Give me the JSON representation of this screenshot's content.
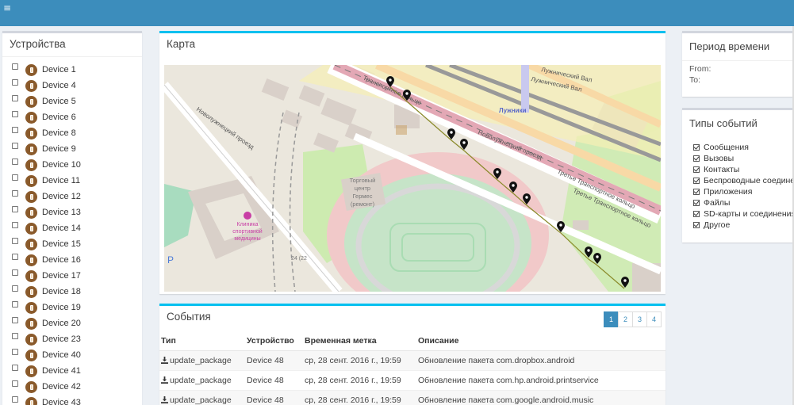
{
  "topbar": {
    "menu_icon": "hamburger-icon",
    "menu_glyph": "≡",
    "color": "#3c8dbc"
  },
  "devices": {
    "title": "Устройства",
    "items": [
      "Device 1",
      "Device 4",
      "Device 5",
      "Device 6",
      "Device 8",
      "Device 9",
      "Device 10",
      "Device 11",
      "Device 12",
      "Device 13",
      "Device 14",
      "Device 15",
      "Device 16",
      "Device 17",
      "Device 18",
      "Device 19",
      "Device 20",
      "Device 23",
      "Device 40",
      "Device 41",
      "Device 42",
      "Device 43"
    ],
    "icon": "phone-icon",
    "badge_color": "#8a5a2b"
  },
  "map": {
    "title": "Карта",
    "labels": {
      "road_top": "Транспортное кольцо",
      "road_val1": "Лужнический Вал",
      "road_val2": "Лужнический Вал",
      "station": "Лужники",
      "proezd_left": "Новолужнецкий проезд",
      "proezd_right": "Новолужнецкий проезд",
      "ring_right1": "Третье Транспортное кольцо",
      "ring_right2": "Третье Транспортное кольцо",
      "mall": [
        "Торговый",
        "центр",
        "Гермес",
        "(ремонт)"
      ],
      "clinic": [
        "Клиника",
        "спортивной",
        "медицины"
      ],
      "house": "24 (22",
      "parking": "P"
    },
    "marker_icon": "map-marker-icon"
  },
  "events": {
    "title": "События",
    "pages": [
      "1",
      "2",
      "3",
      "4"
    ],
    "active_page": "1",
    "columns": [
      "Тип",
      "Устройство",
      "Временная метка",
      "Описание"
    ],
    "rows": [
      {
        "type": "update_package",
        "device": "Device 48",
        "time": "ср, 28 сент. 2016 г., 19:59",
        "desc": "Обновление пакета com.dropbox.android"
      },
      {
        "type": "update_package",
        "device": "Device 48",
        "time": "ср, 28 сент. 2016 г., 19:59",
        "desc": "Обновление пакета com.hp.android.printservice"
      },
      {
        "type": "update_package",
        "device": "Device 48",
        "time": "ср, 28 сент. 2016 г., 19:59",
        "desc": "Обновление пакета com.google.android.music"
      }
    ],
    "type_icon": "download-icon"
  },
  "period": {
    "title": "Период времени",
    "from_label": "From:",
    "to_label": "To:"
  },
  "event_types": {
    "title": "Типы событий",
    "items": [
      "Сообщения",
      "Вызовы",
      "Контакты",
      "Беспроводные соединения",
      "Приложения",
      "Файлы",
      "SD-карты и соединения",
      "Другое"
    ]
  }
}
